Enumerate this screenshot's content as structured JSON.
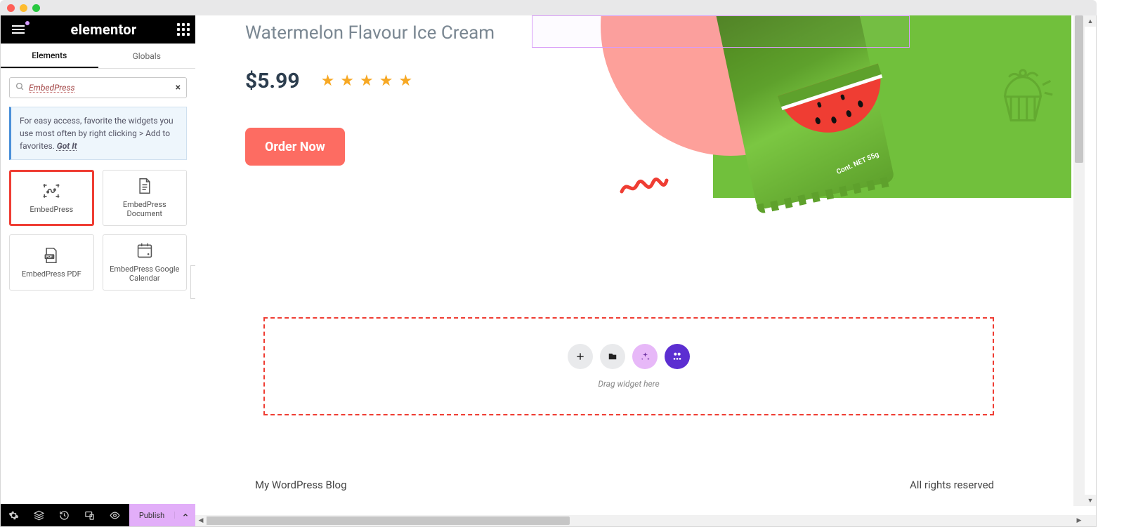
{
  "brand": "elementor",
  "tabs": {
    "elements": "Elements",
    "globals": "Globals"
  },
  "search": {
    "value": "EmbedPress",
    "clear": "×"
  },
  "tip": {
    "text": "For easy access, favorite the widgets you use most often by right clicking > Add to favorites.",
    "gotit": "Got It"
  },
  "widgets": {
    "w1": "EmbedPress",
    "w2": "EmbedPress Document",
    "w3": "EmbedPress PDF",
    "w4": "EmbedPress Google Calendar"
  },
  "sideFooter": {
    "publish": "Publish"
  },
  "product": {
    "title": "Watermelon Flavour Ice Cream",
    "price": "$5.99",
    "orderNow": "Order Now",
    "bagText": "Cont. NET 55g"
  },
  "dropzone": {
    "hint": "Drag widget here"
  },
  "footer": {
    "left": "My WordPress Blog",
    "right": "All rights reserved"
  }
}
